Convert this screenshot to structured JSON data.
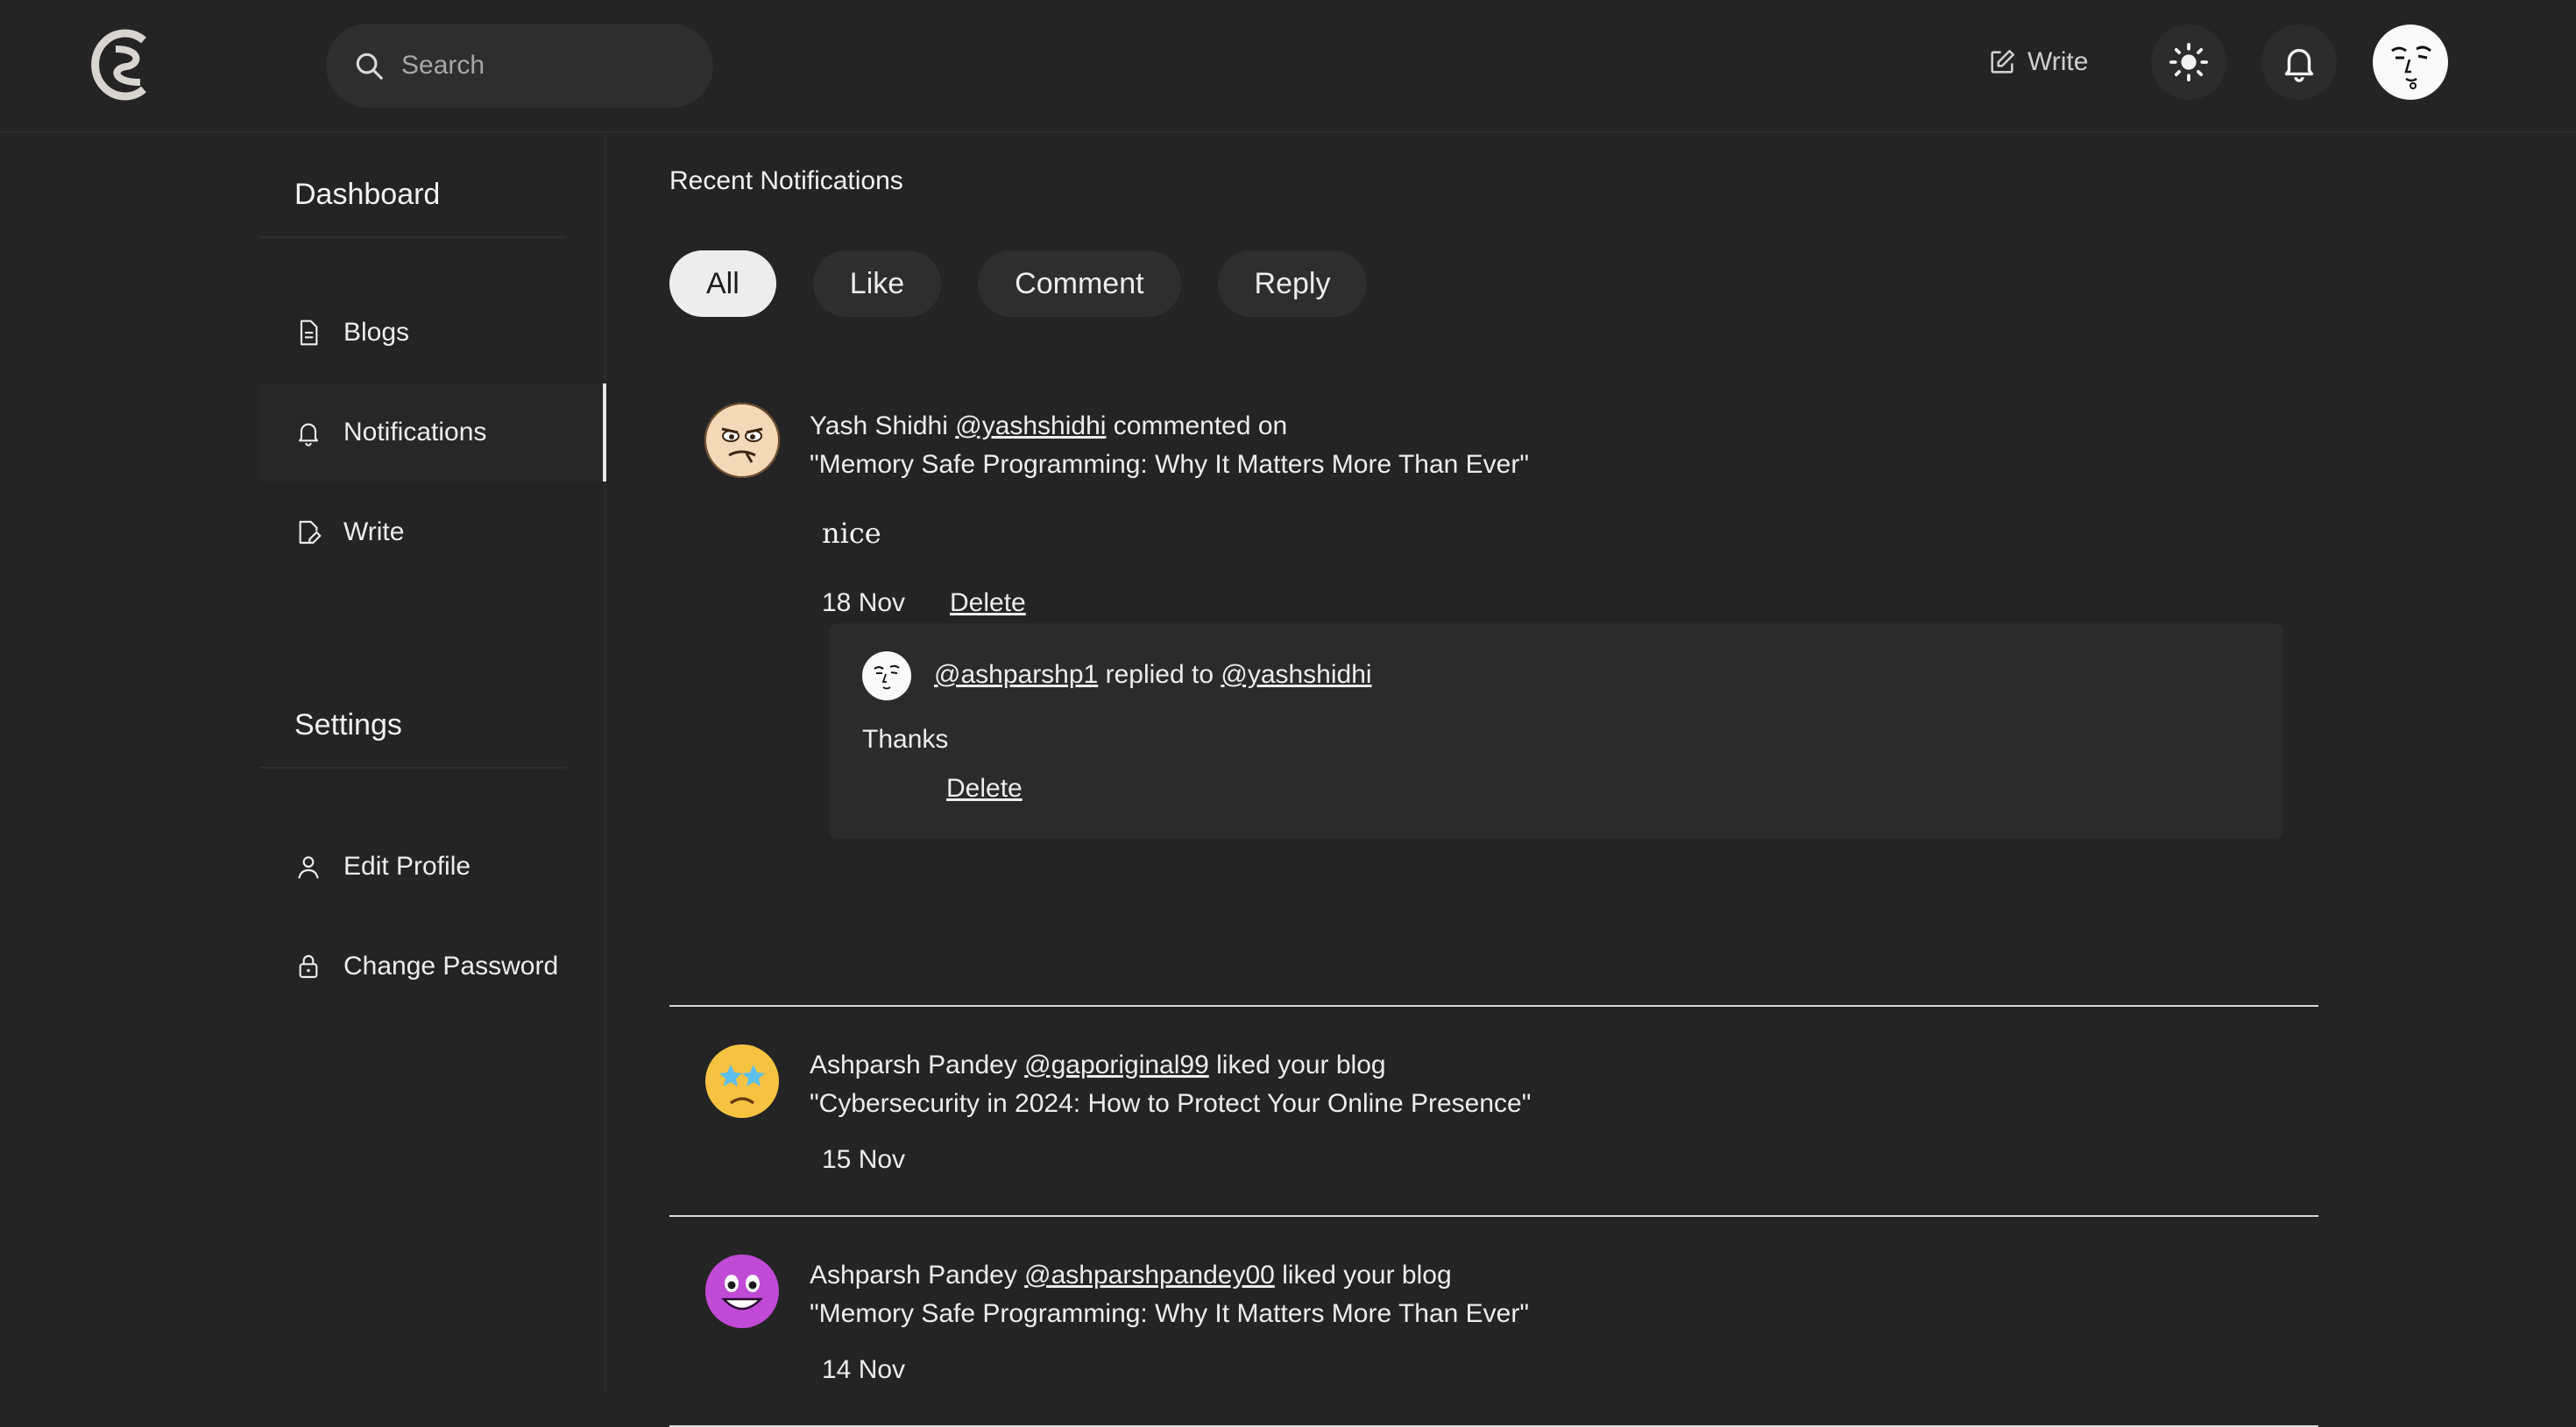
{
  "navbar": {
    "logo": "cs-logo",
    "search_placeholder": "Search",
    "write_label": "Write",
    "theme_icon": "sun-icon",
    "notif_icon": "bell-icon"
  },
  "sidebar": {
    "dashboard_title": "Dashboard",
    "items": [
      {
        "label": "Blogs",
        "icon": "file-icon"
      },
      {
        "label": "Notifications",
        "icon": "bell-icon"
      },
      {
        "label": "Write",
        "icon": "pen-file-icon"
      }
    ],
    "settings_title": "Settings",
    "settings_items": [
      {
        "label": "Edit Profile",
        "icon": "user-icon"
      },
      {
        "label": "Change Password",
        "icon": "lock-icon"
      }
    ]
  },
  "main": {
    "title": "Recent Notifications",
    "tabs": [
      "All",
      "Like",
      "Comment",
      "Reply"
    ],
    "active_tab": "All",
    "notifications": [
      {
        "name": "Yash Shidhi",
        "handle": "@yashshidhi",
        "action": "commented on",
        "blog": "\"Memory Safe Programming: Why It Matters More Than Ever\"",
        "comment": "nice",
        "date": "18 Nov",
        "delete_label": "Delete",
        "reply": {
          "handle": "@ashparshp1",
          "action": "replied to",
          "target": "@yashshidhi",
          "text": "Thanks",
          "delete_label": "Delete"
        }
      },
      {
        "name": "Ashparsh Pandey",
        "handle": "@gaporiginal99",
        "action": "liked your blog",
        "blog": "\"Cybersecurity in 2024: How to Protect Your Online Presence\"",
        "date": "15 Nov"
      },
      {
        "name": "Ashparsh Pandey",
        "handle": "@ashparshpandey00",
        "action": "liked your blog",
        "blog": "\"Memory Safe Programming: Why It Matters More Than Ever\"",
        "date": "14 Nov"
      }
    ]
  },
  "colors": {
    "background": "#242424",
    "surface": "#2e2e2e",
    "text": "#ededed",
    "active_tab_bg": "#ededed"
  }
}
